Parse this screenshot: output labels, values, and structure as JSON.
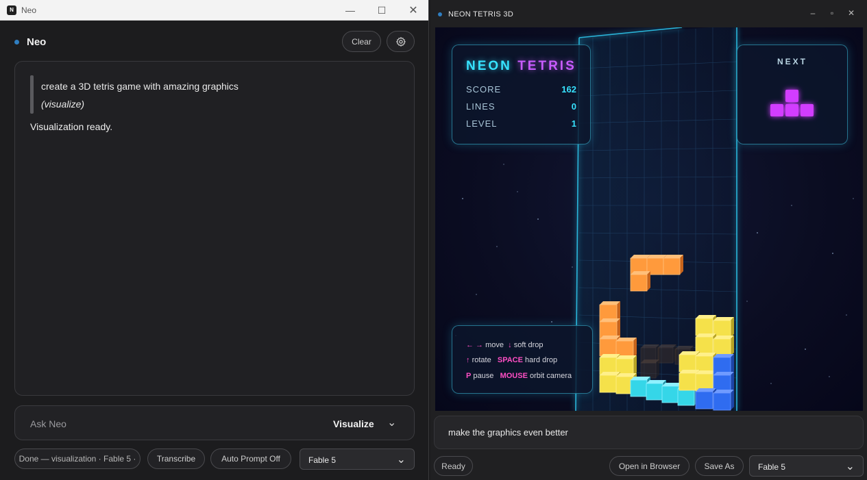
{
  "left_window": {
    "titlebar": {
      "title": "Neo",
      "icon_letter": "N"
    },
    "header": {
      "title": "Neo",
      "clear_label": "Clear"
    },
    "chat": {
      "user_message": "create a 3D tetris game with amazing graphics",
      "user_tag": "(visualize)",
      "assistant_reply": "Visualization ready."
    },
    "ask": {
      "placeholder": "Ask Neo",
      "mode": "Visualize"
    },
    "footer": {
      "status": "Done — visualization · Fable 5 ·",
      "transcribe_label": "Transcribe",
      "auto_prompt_label": "Auto Prompt Off",
      "model_select": "Fable 5"
    }
  },
  "right_window": {
    "titlebar": {
      "title": "NEON TETRIS 3D"
    },
    "game": {
      "logo_part1": "NEON",
      "logo_part2": "TETRIS",
      "score_label": "SCORE",
      "score_value": "162",
      "lines_label": "LINES",
      "lines_value": "0",
      "level_label": "LEVEL",
      "level_value": "1",
      "next_label": "NEXT",
      "controls": {
        "move_keys": "← →",
        "move_text": "move",
        "soft_key": "↓",
        "soft_text": "soft drop",
        "rotate_key": "↑",
        "rotate_text": "rotate",
        "hard_key": "SPACE",
        "hard_text": "hard drop",
        "pause_key": "P",
        "pause_text": "pause",
        "orbit_key": "MOUSE",
        "orbit_text": "orbit camera"
      }
    },
    "prompt_text": "make the graphics even better",
    "footer": {
      "status": "Ready",
      "open_browser_label": "Open in Browser",
      "save_as_label": "Save As",
      "model_select": "Fable 5"
    }
  },
  "colors": {
    "accent_blue": "#2f7ec1",
    "neon_cyan": "#37e3ff",
    "neon_magenta": "#c85cff",
    "neon_pink": "#ff4fc4"
  },
  "icons": [
    "app-icon",
    "minimize-icon",
    "maximize-icon",
    "close-icon",
    "gear-icon",
    "chevron-down-icon",
    "status-dot-icon"
  ]
}
